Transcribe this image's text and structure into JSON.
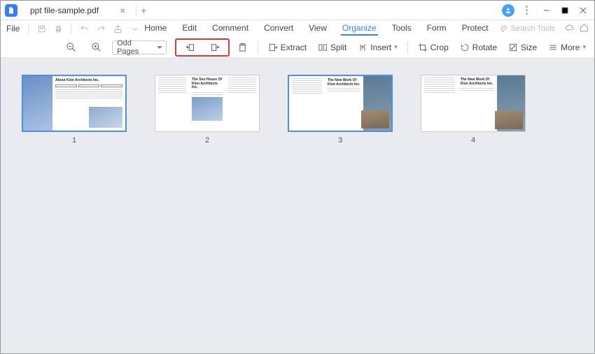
{
  "tab": {
    "title": "ppt file-sample.pdf"
  },
  "menubar": {
    "file": "File",
    "tabs": [
      "Home",
      "Edit",
      "Comment",
      "Convert",
      "View",
      "Organize",
      "Tools",
      "Form",
      "Protect"
    ],
    "active_tab": "Organize",
    "search_placeholder": "Search Tools"
  },
  "toolbar": {
    "page_filter": "Odd Pages",
    "extract": "Extract",
    "split": "Split",
    "insert": "Insert",
    "crop": "Crop",
    "rotate": "Rotate",
    "size": "Size",
    "more": "More"
  },
  "thumbs": [
    {
      "num": "1",
      "title": "About Klon Architects Inc.",
      "selected": true,
      "layout": "A"
    },
    {
      "num": "2",
      "title": "The Seo House Of Klon Architects Inc.",
      "selected": false,
      "layout": "B"
    },
    {
      "num": "3",
      "title": "The New Work Of Klon Architects Inc.",
      "selected": true,
      "layout": "C"
    },
    {
      "num": "4",
      "title": "The New Work Of Klon Architects Inc.",
      "selected": false,
      "layout": "C"
    }
  ]
}
